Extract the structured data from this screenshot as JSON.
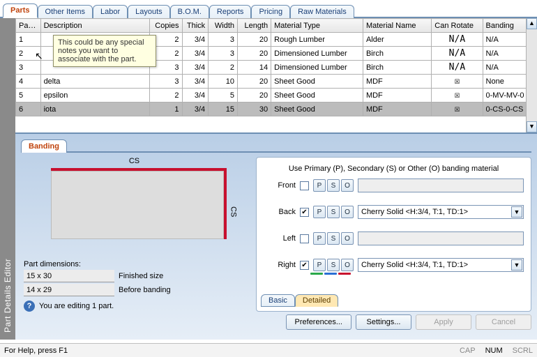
{
  "tabs": [
    "Parts",
    "Other Items",
    "Labor",
    "Layouts",
    "B.O.M.",
    "Reports",
    "Pricing",
    "Raw Materials"
  ],
  "activeTab": 0,
  "sideTitle": "Part Details Editor",
  "columns": [
    "Part #",
    "Description",
    "Copies",
    "Thick",
    "Width",
    "Length",
    "Material Type",
    "Material Name",
    "Can Rotate",
    "Banding"
  ],
  "rows": [
    {
      "n": "1",
      "desc": "",
      "copies": "2",
      "thick": "3/4",
      "width": "3",
      "length": "20",
      "mtype": "Rough Lumber",
      "mname": "Alder",
      "rotate": "N/A",
      "band": "N/A"
    },
    {
      "n": "2",
      "desc": "",
      "copies": "2",
      "thick": "3/4",
      "width": "3",
      "length": "20",
      "mtype": "Dimensioned Lumber",
      "mname": "Birch",
      "rotate": "N/A",
      "band": "N/A"
    },
    {
      "n": "3",
      "desc": "",
      "copies": "3",
      "thick": "3/4",
      "width": "2",
      "length": "14",
      "mtype": "Dimensioned Lumber",
      "mname": "Birch",
      "rotate": "N/A",
      "band": "N/A"
    },
    {
      "n": "4",
      "desc": "delta",
      "copies": "3",
      "thick": "3/4",
      "width": "10",
      "length": "20",
      "mtype": "Sheet Good",
      "mname": "MDF",
      "rotate": "☒",
      "band": "None"
    },
    {
      "n": "5",
      "desc": "epsilon",
      "copies": "2",
      "thick": "3/4",
      "width": "5",
      "length": "20",
      "mtype": "Sheet Good",
      "mname": "MDF",
      "rotate": "☒",
      "band": "0-MV-MV-0"
    },
    {
      "n": "6",
      "desc": "iota",
      "copies": "1",
      "thick": "3/4",
      "width": "15",
      "length": "30",
      "mtype": "Sheet Good",
      "mname": "MDF",
      "rotate": "☒",
      "band": "0-CS-0-CS"
    }
  ],
  "selectedRow": 5,
  "tooltip": "This could be any special notes you want to associate with the part.",
  "lowerTab": "Banding",
  "preview": {
    "topLabel": "CS",
    "rightLabel": "CS"
  },
  "dims": {
    "label": "Part dimensions:",
    "finished": "15 x 30",
    "finishedLabel": "Finished size",
    "before": "14 x 29",
    "beforeLabel": "Before banding"
  },
  "editingMsg": "You are editing 1 part.",
  "banding": {
    "hint": "Use Primary (P), Secondary (S) or Other (O) banding material",
    "labels": {
      "front": "Front",
      "back": "Back",
      "left": "Left",
      "right": "Right",
      "p": "P",
      "s": "S",
      "o": "O"
    },
    "edges": {
      "front": {
        "checked": false,
        "value": ""
      },
      "back": {
        "checked": true,
        "value": "Cherry Solid <H:3/4, T:1, TD:1>"
      },
      "left": {
        "checked": false,
        "value": ""
      },
      "right": {
        "checked": true,
        "value": "Cherry Solid <H:3/4, T:1, TD:1>"
      }
    },
    "subtabs": [
      "Basic",
      "Detailed"
    ],
    "activeSubtab": 1
  },
  "buttons": {
    "prefs": "Preferences...",
    "settings": "Settings...",
    "apply": "Apply",
    "cancel": "Cancel"
  },
  "status": {
    "left": "For Help, press F1",
    "cap": "CAP",
    "num": "NUM",
    "scrl": "SCRL"
  }
}
